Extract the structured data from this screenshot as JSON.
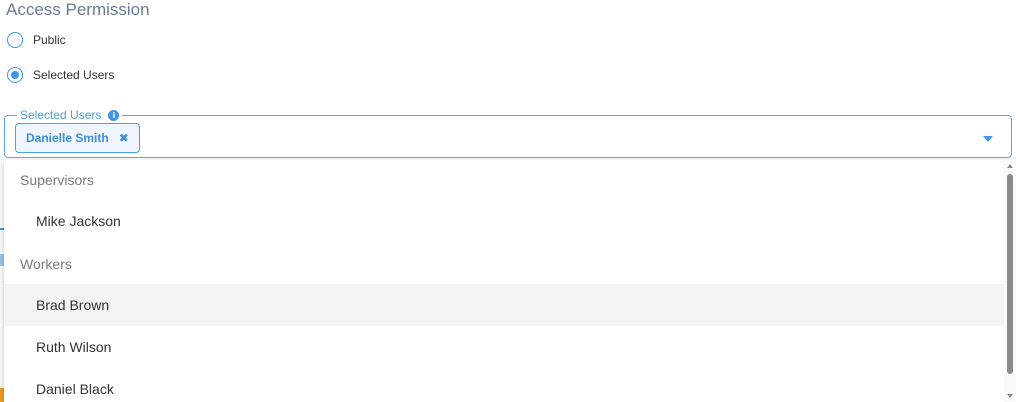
{
  "access": {
    "title": "Access Permission",
    "options": [
      {
        "label": "Public",
        "selected": false
      },
      {
        "label": "Selected Users",
        "selected": true
      }
    ]
  },
  "selected_users_field": {
    "legend": "Selected Users",
    "info_icon": "info-icon",
    "chips": [
      {
        "label": "Danielle Smith",
        "remove_icon": "close-icon"
      }
    ],
    "arrow_icon": "chevron-down-icon"
  },
  "menu": {
    "groups": [
      {
        "header": "Supervisors",
        "items": [
          "Mike Jackson"
        ]
      },
      {
        "header": "Workers",
        "items": [
          "Brad Brown",
          "Ruth Wilson",
          "Daniel Black"
        ]
      }
    ],
    "highlighted": "Brad Brown"
  },
  "colors": {
    "accent": "#3f97e8",
    "title": "#6b7a99",
    "chip_bg": "#eef5fc",
    "highlight": "#f3f3f3"
  }
}
